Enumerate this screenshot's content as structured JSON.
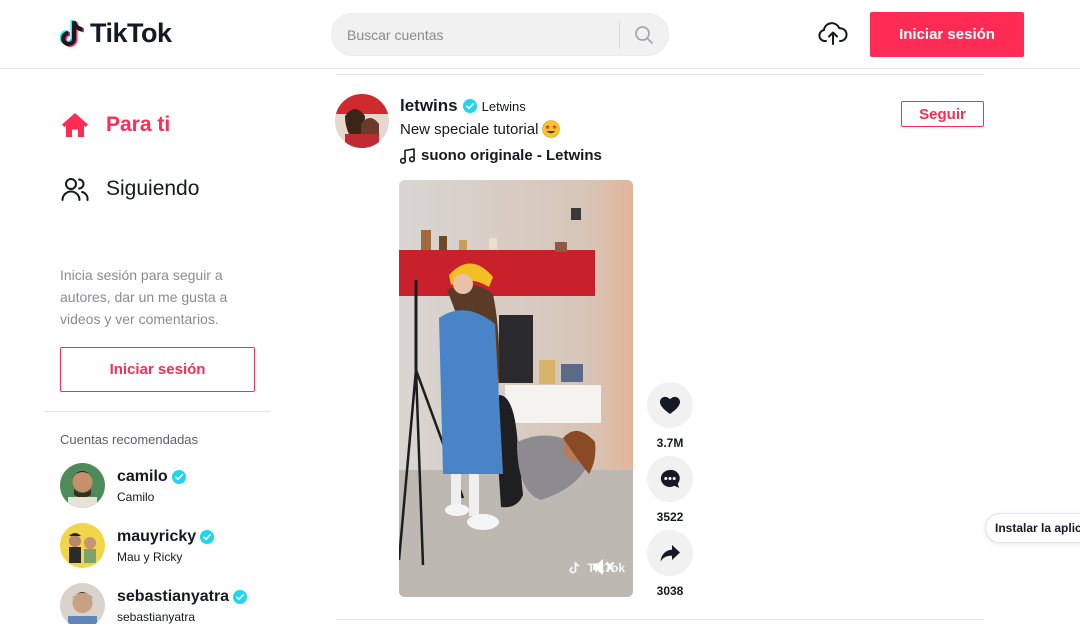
{
  "header": {
    "logo_text": "TikTok",
    "search_placeholder": "Buscar cuentas",
    "login_label": "Iniciar sesión"
  },
  "sidebar": {
    "nav": [
      {
        "label": "Para ti",
        "icon": "home-icon",
        "active": true
      },
      {
        "label": "Siguiendo",
        "icon": "users-icon",
        "active": false
      }
    ],
    "login_prompt": "Inicia sesión para seguir a autores, dar un me gusta a videos y ver comentarios.",
    "login_label": "Iniciar sesión",
    "recommended_title": "Cuentas recomendadas",
    "recommended": [
      {
        "username": "camilo",
        "nickname": "Camilo",
        "verified": true
      },
      {
        "username": "mauyricky",
        "nickname": "Mau y Ricky",
        "verified": true
      },
      {
        "username": "sebastianyatra",
        "nickname": "sebastianyatra",
        "verified": true
      }
    ]
  },
  "post": {
    "username": "letwins",
    "nickname": "Letwins",
    "verified": true,
    "caption": "New speciale tutorial",
    "caption_emoji": "star-struck-emoji",
    "music": "suono originale - Letwins",
    "follow_label": "Seguir",
    "likes": "3.7M",
    "comments": "3522",
    "shares": "3038",
    "watermark": "TikTok"
  },
  "install_pill": "Instalar la aplic",
  "colors": {
    "accent": "#fe2c55",
    "verified": "#20d5ec",
    "text": "#161823",
    "muted": "#8a8b91"
  }
}
